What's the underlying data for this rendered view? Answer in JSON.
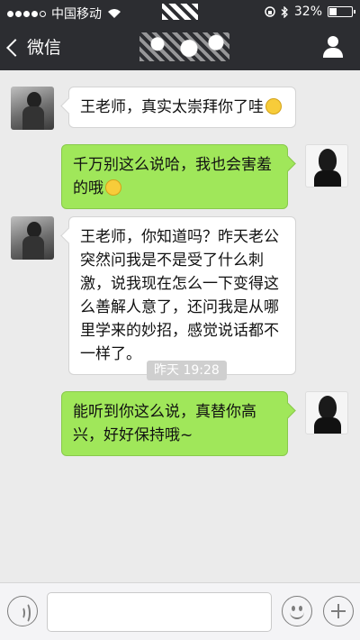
{
  "status_bar": {
    "carrier": "中国移动",
    "battery": "32%",
    "battery_level": 0.32
  },
  "nav": {
    "back_label": "微信",
    "title_obscured": true
  },
  "messages": [
    {
      "side": "left",
      "text": "王老师，真实太崇拜你了哇",
      "emoji": "smile-emoji"
    },
    {
      "side": "right",
      "text": "千万别这么说哈，我也会害羞的哦",
      "emoji": "grin-emoji"
    },
    {
      "side": "left",
      "text": "王老师，你知道吗？昨天老公突然问我是不是受了什么刺激，说我现在怎么一下变得这么善解人意了，还问我是从哪里学来的妙招，感觉说话都不一样了。"
    },
    {
      "side": "right",
      "text": "能听到你这么说，真替你高兴，好好保持哦~"
    }
  ],
  "timestamp": "昨天 19:28",
  "input": {
    "placeholder": "",
    "value": ""
  },
  "icons": {
    "back": "chevron-left-icon",
    "contact": "person-icon",
    "voice": "voice-icon",
    "emoji": "emoji-icon",
    "more": "plus-icon"
  },
  "colors": {
    "bar": "#2c2d31",
    "chat_bg": "#ebebeb",
    "my_bubble": "#a0e75a",
    "their_bubble": "#ffffff"
  }
}
